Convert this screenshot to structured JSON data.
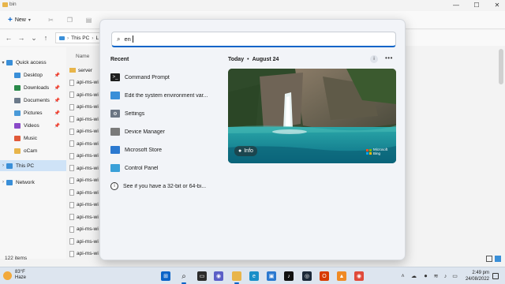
{
  "window": {
    "title": "bin",
    "controls": {
      "minimize": "—",
      "maximize": "☐",
      "close": "✕"
    }
  },
  "toolbar": {
    "new_label": "New"
  },
  "address": {
    "segments": [
      "This PC",
      "L"
    ]
  },
  "nav_pane": [
    {
      "label": "Quick access",
      "type": "star",
      "color": "#3a8fd8",
      "expand": "▾"
    },
    {
      "label": "Desktop",
      "type": "desk",
      "color": "#3a8fd8",
      "pinned": true
    },
    {
      "label": "Downloads",
      "type": "down",
      "color": "#2a8a4a",
      "pinned": true
    },
    {
      "label": "Documents",
      "type": "doc",
      "color": "#6c7a8a",
      "pinned": true
    },
    {
      "label": "Pictures",
      "type": "pic",
      "color": "#4a9ad8",
      "pinned": true
    },
    {
      "label": "Videos",
      "type": "vid",
      "color": "#8a4ac8",
      "pinned": true
    },
    {
      "label": "Music",
      "type": "music",
      "color": "#e05a3a"
    },
    {
      "label": "oCam",
      "type": "folder",
      "color": "#e8b54a"
    },
    {
      "label": "This PC",
      "type": "pc",
      "color": "#3a8fd8",
      "selected": true,
      "expand": "›"
    },
    {
      "label": "Network",
      "type": "net",
      "color": "#3a8fd8",
      "expand": "›"
    }
  ],
  "file_list": {
    "column_header": "Name",
    "rows": [
      "server",
      "api-ms-wi",
      "api-ms-wi",
      "api-ms-wi",
      "api-ms-wi",
      "api-ms-wi",
      "api-ms-wi",
      "api-ms-wi",
      "api-ms-wi",
      "api-ms-wi",
      "api-ms-wi",
      "api-ms-wi",
      "api-ms-wi",
      "api-ms-wi",
      "api-ms-wi",
      "api-ms-wi"
    ]
  },
  "status": {
    "item_count": "122 items"
  },
  "search": {
    "query": "en",
    "recent_header": "Recent",
    "recent": [
      {
        "label": "Command Prompt",
        "icon": "cmd-icon",
        "color": "#1e1e1e",
        "glyph": ">_"
      },
      {
        "label": "Edit the system environment var...",
        "icon": "monitor-icon",
        "color": "#3a8fd8",
        "glyph": ""
      },
      {
        "label": "Settings",
        "icon": "gear-icon",
        "color": "#6b7684",
        "glyph": "⚙"
      },
      {
        "label": "Device Manager",
        "icon": "device-manager-icon",
        "color": "#7a7a7a",
        "glyph": ""
      },
      {
        "label": "Microsoft Store",
        "icon": "store-icon",
        "color": "#2b79d0",
        "glyph": ""
      },
      {
        "label": "Control Panel",
        "icon": "control-panel-icon",
        "color": "#3aa0d8",
        "glyph": ""
      },
      {
        "label": "See if you have a 32-bit or 64-bi...",
        "icon": "info-icon",
        "color": "#ffffff",
        "glyph": "i"
      }
    ],
    "today": {
      "label": "Today",
      "date": "August 24"
    },
    "hero": {
      "info_label": "Info",
      "badge_line1": "Microsoft",
      "badge_line2": "Bing"
    }
  },
  "taskbar": {
    "weather": {
      "temp": "83°F",
      "condition": "Haze"
    },
    "apps": [
      {
        "name": "start-button-icon",
        "color": "#0a64c8",
        "glyph": "⊞"
      },
      {
        "name": "search-icon",
        "color": "#dde5ef",
        "glyph": "⌕",
        "active": true
      },
      {
        "name": "task-view-icon",
        "color": "#2b2b2b",
        "glyph": "▭"
      },
      {
        "name": "chat-icon",
        "color": "#5b5fc7",
        "glyph": "◉"
      },
      {
        "name": "file-explorer-icon",
        "color": "#e8b54a",
        "glyph": "",
        "active": true
      },
      {
        "name": "edge-icon",
        "color": "#1a8fc8",
        "glyph": "e"
      },
      {
        "name": "store-icon",
        "color": "#2b79d0",
        "glyph": "▣"
      },
      {
        "name": "tiktok-icon",
        "color": "#111111",
        "glyph": "♪"
      },
      {
        "name": "steam-icon",
        "color": "#1b2838",
        "glyph": "◎"
      },
      {
        "name": "office-icon",
        "color": "#d83b01",
        "glyph": "O"
      },
      {
        "name": "vlc-icon",
        "color": "#f08a24",
        "glyph": "▲"
      },
      {
        "name": "chrome-icon",
        "color": "#e04a3a",
        "glyph": "◉"
      }
    ],
    "tray": {
      "time": "2:49 pm",
      "date": "24/08/2022"
    }
  }
}
